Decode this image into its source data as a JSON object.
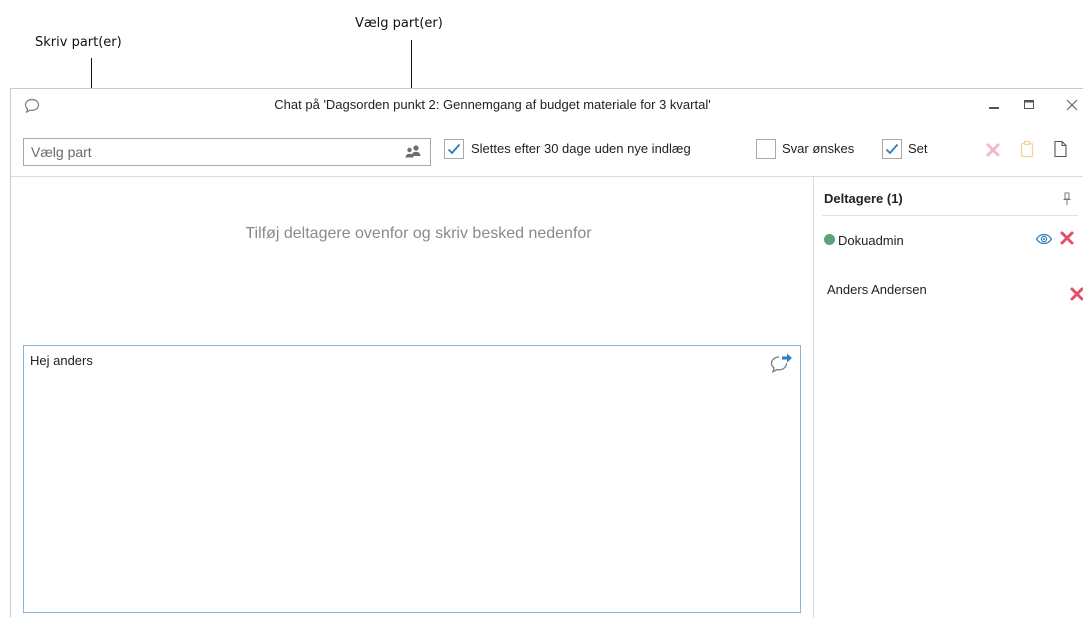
{
  "callouts": {
    "write_parties": "Skriv part(er)",
    "choose_parties": "Vælg part(er)"
  },
  "window": {
    "title": "Chat på 'Dagsorden punkt 2: Gennemgang af budget materiale for 3 kvartal'",
    "controls": [
      "minimize-icon",
      "maximize-icon",
      "close-icon"
    ]
  },
  "toolbar": {
    "party_input": {
      "placeholder": "Vælg part",
      "value": ""
    },
    "delete_after_30": {
      "label": "Slettes efter 30 dage uden nye indlæg",
      "checked": true
    },
    "reply_wanted": {
      "label": "Svar ønskes",
      "checked": false
    },
    "seen": {
      "label": "Set",
      "checked": true
    },
    "actions": [
      "delete-icon",
      "clipboard-icon",
      "new-document-icon"
    ]
  },
  "chat": {
    "hint": "Tilføj deltagere ovenfor og skriv besked nedenfor",
    "message": "Hej anders"
  },
  "participants": {
    "header": "Deltagere (1)",
    "items": [
      {
        "name": "Dokuadmin",
        "status_color": "#5ba37c",
        "has_status": true,
        "has_eye": true
      },
      {
        "name": "Anders Andersen",
        "has_status": false,
        "has_eye": false
      }
    ]
  },
  "colors": {
    "accent_blue": "#2f7fc1",
    "remove_red": "#e0506a",
    "status_green": "#5ba37c"
  }
}
